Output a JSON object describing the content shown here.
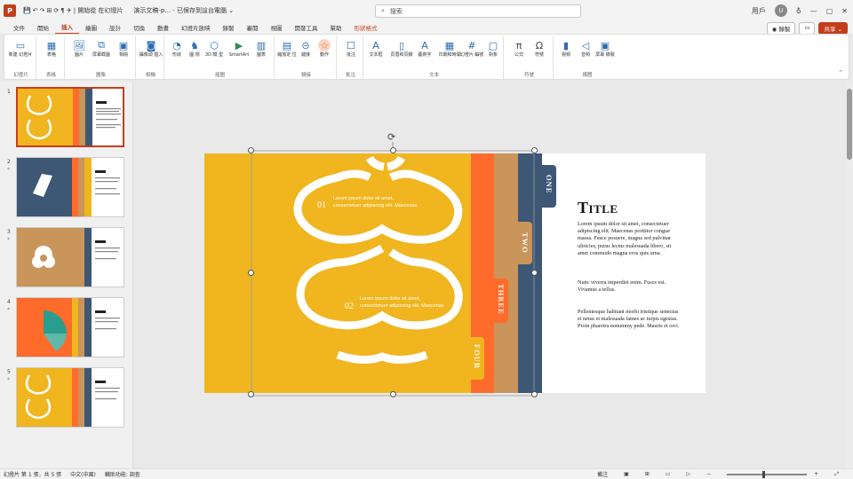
{
  "titlebar": {
    "qa_undo": "↶",
    "qa_redo": "↷",
    "qa_item1": "⊞",
    "qa_item2": "⟳",
    "qa_item3": "¶",
    "qa_item4": "✈ | 開始從",
    "qa_item5": "在幻燈片",
    "doc_title": "演示文稿-p... - 已保存到這台電腦 ⌄",
    "search_placeholder": "搜索",
    "user_name": "用戶",
    "user_initial": "U"
  },
  "tabs": [
    "文件",
    "開始",
    "插入",
    "繪圖",
    "設計",
    "切換",
    "動畫",
    "幻燈片放映",
    "錄製",
    "審閱",
    "視圖",
    "開發工具",
    "幫助",
    "形狀格式"
  ],
  "active_tab": "插入",
  "right_tabs": {
    "record": "◉ 錄製",
    "comment": "▭",
    "share": "共享 ⌄"
  },
  "ribbon_groups": [
    {
      "label": "幻燈片",
      "buttons": [
        "新建\n幻燈片"
      ]
    },
    {
      "label": "表格",
      "buttons": [
        "表格"
      ]
    },
    {
      "label": "圖像",
      "buttons": [
        "圖片",
        "屏幕截圖",
        "相冊"
      ]
    },
    {
      "label": "相機",
      "buttons": [
        "攝像頭\n插入"
      ]
    },
    {
      "label": "插圖",
      "buttons": [
        "形狀",
        "圖\n標",
        "3D 模\n型",
        "SmartArt",
        "圖表"
      ]
    },
    {
      "label": "鏈接",
      "buttons": [
        "縮放定\n位",
        "鏈接",
        "動作"
      ]
    },
    {
      "label": "批注",
      "buttons": [
        "批注"
      ]
    },
    {
      "label": "文本",
      "buttons": [
        "文本框",
        "頁眉和頁腳",
        "藝術字",
        "日期和時間",
        "幻燈片\n編號",
        "對象"
      ]
    },
    {
      "label": "符號",
      "buttons": [
        "公式",
        "符號"
      ]
    },
    {
      "label": "媒體",
      "buttons": [
        "視頻",
        "音頻",
        "屏幕\n錄製"
      ]
    }
  ],
  "slides": [
    {
      "num": "1",
      "star": ""
    },
    {
      "num": "2",
      "star": "*"
    },
    {
      "num": "3",
      "star": "*"
    },
    {
      "num": "4",
      "star": "*"
    },
    {
      "num": "5",
      "star": "*"
    }
  ],
  "slide": {
    "title": "Title",
    "para1": "Lorem ipsum dolor sit amet, consectetuer adipiscing elit. Maecenas porttitor congue massa. Fusce posuere, magna sed pulvinar ultricies, purus lectus malesuada libero, sit amet commodo magna eros quis urna.",
    "para2": "Nunc viverra imperdiet enim. Fusce est. Vivamus a tellus.",
    "para3": "Pellentesque habitant morbi tristique senectus et netus et malesuada fames ac turpis egestas. Proin pharetra nonummy pede. Mauris et orci.",
    "tab_one": "ONE",
    "tab_two": "TWO",
    "tab_three": "THREE",
    "tab_four": "FOUR",
    "blob1_num": "01",
    "blob1_text": "Lorem ipsum dolor sit amet, consectetuer adipiscing elit. Maecenas",
    "blob2_num": "02",
    "blob2_text": "Lorem ipsum dolor sit amet, consectetuer adipiscing elit. Maecenas"
  },
  "status": {
    "slide_pos": "幻燈片 第 1 張，共 5 張",
    "lang": "中文(中國)",
    "accessibility": "輔助功能: 調查",
    "notes": "備注",
    "zoom": "+"
  },
  "colors": {
    "accent": "#c43e1c",
    "yellow": "#f0b51f",
    "orange": "#ff6b2b",
    "tan": "#c9955a",
    "navy": "#3d5775"
  }
}
